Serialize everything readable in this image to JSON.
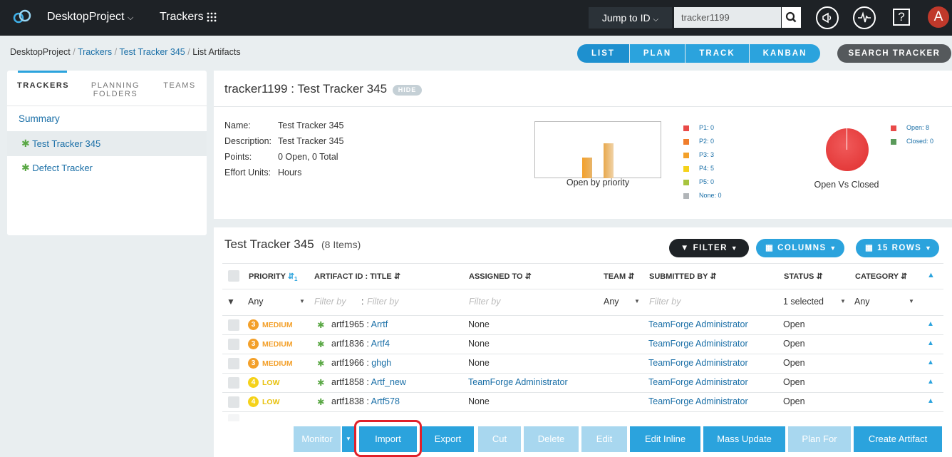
{
  "topbar": {
    "project": "DesktopProject",
    "section": "Trackers",
    "jump_label": "Jump to ID",
    "search_value": "tracker1199",
    "avatar_letter": "A"
  },
  "breadcrumb": {
    "items": [
      "DesktopProject",
      "Trackers",
      "Test Tracker 345",
      "List Artifacts"
    ]
  },
  "view_tabs": [
    "LIST",
    "PLAN",
    "TRACK",
    "KANBAN"
  ],
  "search_tracker": "SEARCH TRACKER",
  "left_tabs": [
    "TRACKERS",
    "PLANNING FOLDERS",
    "TEAMS"
  ],
  "left_nav": {
    "summary": "Summary",
    "trackers": [
      "Test Tracker 345",
      "Defect Tracker"
    ]
  },
  "info": {
    "title": "tracker1199 : Test Tracker 345",
    "hide": "HIDE",
    "fields": [
      {
        "label": "Name:",
        "value": "Test Tracker 345"
      },
      {
        "label": "Description:",
        "value": "Test Tracker 345"
      },
      {
        "label": "Points:",
        "value": "0 Open, 0 Total"
      },
      {
        "label": "Effort Units:",
        "value": "Hours"
      }
    ],
    "priority_chart_caption": "Open by priority",
    "priority_legend": [
      "P1: 0",
      "P2: 0",
      "P3: 3",
      "P4: 5",
      "P5: 0",
      "None: 0"
    ],
    "pie_caption": "Open Vs Closed",
    "pie_legend": [
      "Open: 8",
      "Closed: 0"
    ]
  },
  "colors": {
    "accent": "#2ba3dd",
    "p1": "#e94a48",
    "p2": "#f07d2b",
    "p3": "#f3a02a",
    "p4": "#f5d21a",
    "p5": "#a7c43e",
    "none": "#b1b5b8",
    "closed": "#5a9a5a"
  },
  "list": {
    "title": "Test Tracker 345",
    "count": "(8 Items)",
    "filter_btn": "FILTER",
    "columns_btn": "COLUMNS",
    "rows_btn": "15 ROWS",
    "headers": {
      "priority": "PRIORITY",
      "artifact": "ARTIFACT ID : TITLE",
      "assigned": "ASSIGNED TO",
      "team": "TEAM",
      "submitted": "SUBMITTED BY",
      "status": "STATUS",
      "category": "CATEGORY"
    },
    "filters": {
      "priority": "Any",
      "artifact_id": "Filter by",
      "colon": ":",
      "title": "Filter by",
      "assigned": "Filter by",
      "team": "Any",
      "submitted": "Filter by",
      "status": "1 selected",
      "category": "Any"
    },
    "rows": [
      {
        "prio_num": "3",
        "prio": "MEDIUM",
        "id": "artf1965",
        "title": "Arrtf",
        "assigned": "None",
        "submitted": "TeamForge Administrator",
        "status": "Open"
      },
      {
        "prio_num": "3",
        "prio": "MEDIUM",
        "id": "artf1836",
        "title": "Artf4",
        "assigned": "None",
        "submitted": "TeamForge Administrator",
        "status": "Open"
      },
      {
        "prio_num": "3",
        "prio": "MEDIUM",
        "id": "artf1966",
        "title": "ghgh",
        "assigned": "None",
        "submitted": "TeamForge Administrator",
        "status": "Open"
      },
      {
        "prio_num": "4",
        "prio": "LOW",
        "id": "artf1858",
        "title": "Artf_new",
        "assigned": "TeamForge Administrator",
        "submitted": "TeamForge Administrator",
        "status": "Open"
      },
      {
        "prio_num": "4",
        "prio": "LOW",
        "id": "artf1838",
        "title": "Artf578",
        "assigned": "None",
        "submitted": "TeamForge Administrator",
        "status": "Open"
      }
    ]
  },
  "actions": [
    "Monitor",
    "Import",
    "Export",
    "Cut",
    "Delete",
    "Edit",
    "Edit Inline",
    "Mass Update",
    "Plan For",
    "Create Artifact"
  ]
}
